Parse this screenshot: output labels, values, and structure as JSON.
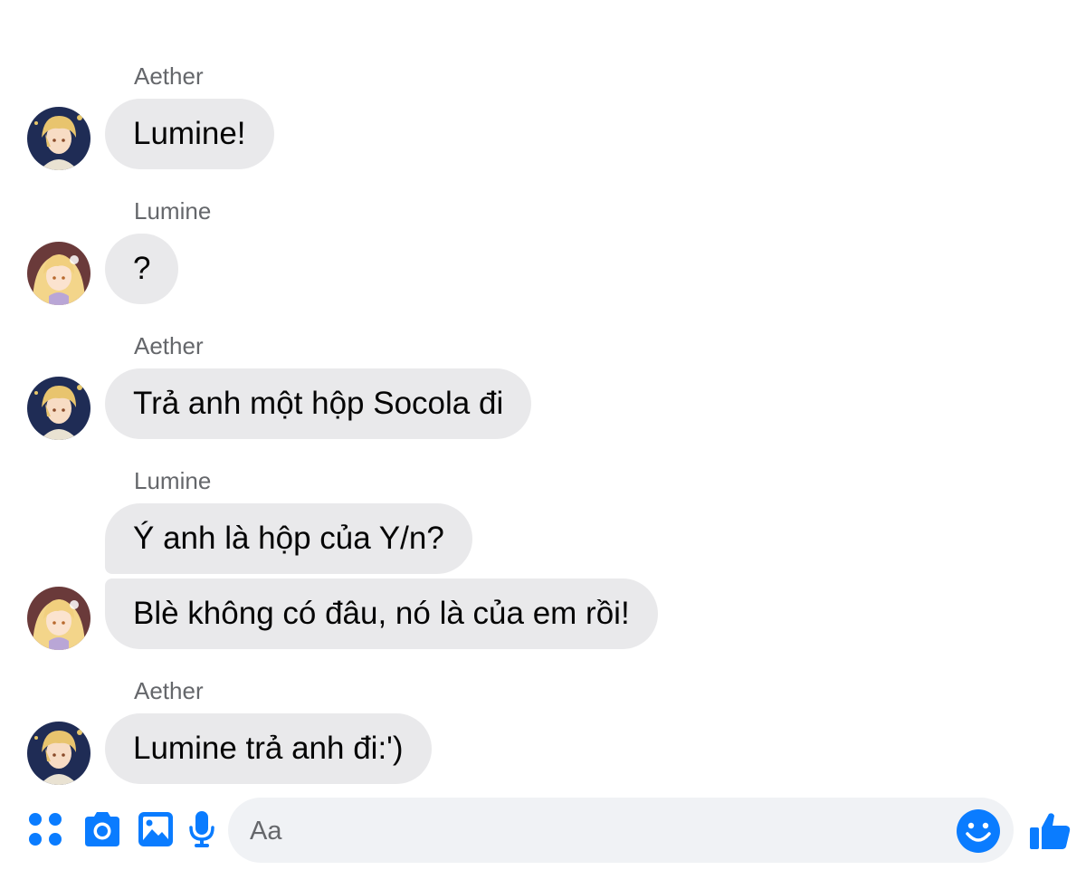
{
  "theme": {
    "accent": "#0a7cff",
    "bubble_bg": "#e9e9eb",
    "input_bg": "#f0f2f5"
  },
  "messages": [
    {
      "sender": "Aether",
      "texts": [
        "Lumine!"
      ]
    },
    {
      "sender": "Lumine",
      "texts": [
        "?"
      ]
    },
    {
      "sender": "Aether",
      "texts": [
        "Trả anh một hộp Socola đi"
      ]
    },
    {
      "sender": "Lumine",
      "texts": [
        "Ý anh là hộp của Y/n?",
        "Blè không có đâu, nó là của em rồi!"
      ]
    },
    {
      "sender": "Aether",
      "texts": [
        "Lumine trả anh đi:')"
      ]
    }
  ],
  "composer": {
    "placeholder": "Aa",
    "icons": [
      "apps-icon",
      "camera-icon",
      "gallery-icon",
      "microphone-icon",
      "emoji-icon",
      "thumbs-up-icon"
    ]
  }
}
